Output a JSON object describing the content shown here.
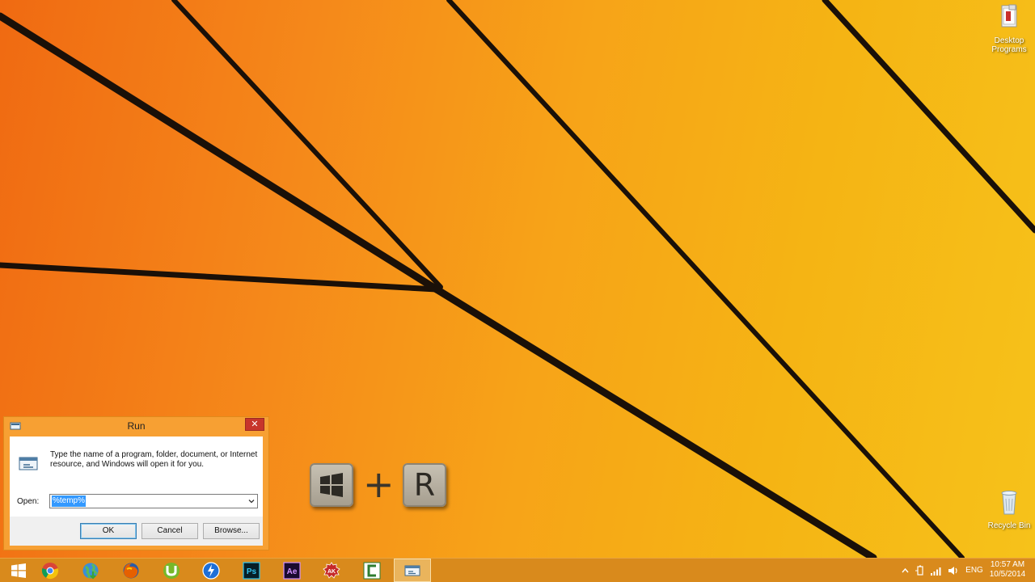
{
  "desktop": {
    "icons": [
      {
        "label": "Desktop Programs",
        "icon": "desktop-programs-icon"
      },
      {
        "label": "Recycle Bin",
        "icon": "recycle-bin-icon"
      }
    ]
  },
  "shortcut_overlay": {
    "windows_key": "windows-logo-icon",
    "plus": "+",
    "letter_key": "R"
  },
  "run_dialog": {
    "title": "Run",
    "close_label": "✕",
    "description": "Type the name of a program, folder, document, or Internet resource, and Windows will open it for you.",
    "open_label": "Open:",
    "open_value": "%temp%",
    "ok_label": "OK",
    "cancel_label": "Cancel",
    "browse_label": "Browse...",
    "colors": {
      "frame": "#f7a033",
      "close": "#c7352b",
      "selection": "#3399ff"
    }
  },
  "taskbar": {
    "color": "#d98a1c",
    "apps": [
      {
        "name": "start",
        "icon": "windows-start-icon"
      },
      {
        "name": "chrome",
        "icon": "chrome-icon"
      },
      {
        "name": "internet-download-manager",
        "icon": "globe-icon"
      },
      {
        "name": "firefox",
        "icon": "firefox-icon"
      },
      {
        "name": "utorrent",
        "icon": "utorrent-icon"
      },
      {
        "name": "flashget",
        "icon": "lightning-icon"
      },
      {
        "name": "photoshop",
        "icon": "photoshop-icon",
        "text": "Ps"
      },
      {
        "name": "after-effects",
        "icon": "after-effects-icon",
        "text": "Ae"
      },
      {
        "name": "ak-app",
        "icon": "ak-icon",
        "text": "AK"
      },
      {
        "name": "camtasia",
        "icon": "camtasia-icon"
      },
      {
        "name": "run",
        "icon": "run-icon"
      }
    ],
    "tray": {
      "language": "ENG",
      "time": "10:57 AM",
      "date": "10/5/2014"
    }
  }
}
